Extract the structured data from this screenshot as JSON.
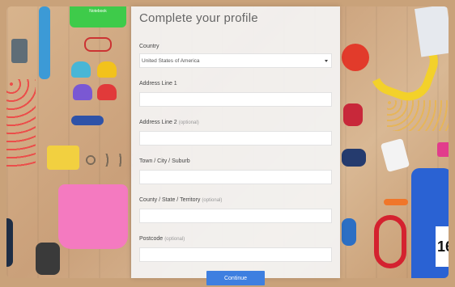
{
  "form": {
    "title": "Complete your profile",
    "country": {
      "label": "Country",
      "value": "United States of America"
    },
    "address1": {
      "label": "Address Line 1",
      "value": ""
    },
    "address2": {
      "label": "Address Line 2",
      "optional": "(optional)",
      "value": ""
    },
    "town": {
      "label": "Town / City / Suburb",
      "value": ""
    },
    "county": {
      "label": "County / State / Territory",
      "optional": "(optional)",
      "value": ""
    },
    "postcode": {
      "label": "Postcode",
      "optional": "(optional)",
      "value": ""
    },
    "continue_label": "Continue"
  },
  "background": {
    "bib_number": "16",
    "tag_text": "Notebook"
  },
  "colors": {
    "button": "#3e7fe0",
    "panel": "#f4f4f4"
  }
}
